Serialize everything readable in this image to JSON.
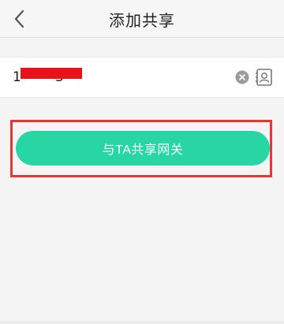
{
  "header": {
    "title": "添加共享",
    "back_icon": "chevron-left-icon"
  },
  "phone_field": {
    "value": "1        3",
    "clear_icon": "clear-circle-icon",
    "contacts_icon": "contacts-book-icon"
  },
  "share_button": {
    "label": "与TA共享网关"
  },
  "colors": {
    "accent": "#28d6a4",
    "highlight": "#e23a33",
    "redaction": "#e5141a",
    "background": "#f4f4f5"
  }
}
